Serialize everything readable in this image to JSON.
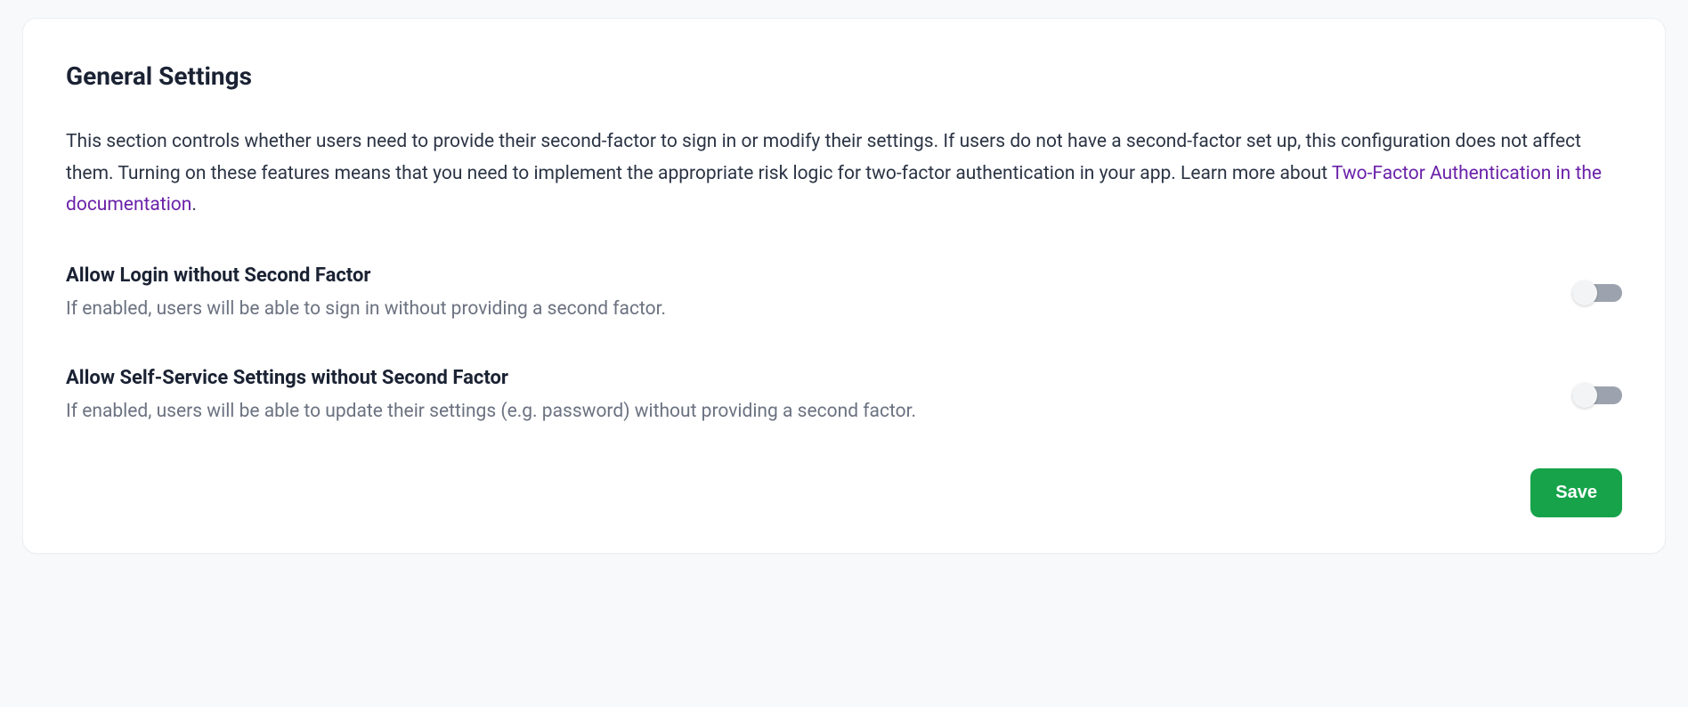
{
  "header": {
    "title": "General Settings"
  },
  "description": {
    "text_before": "This section controls whether users need to provide their second-factor to sign in or modify their settings. If users do not have a second-factor set up, this configuration does not affect them. Turning on these features means that you need to implement the appropriate risk logic for two-factor authentication in your app. Learn more about ",
    "link_text": "Two-Factor Authentication in the documentation",
    "text_after": "."
  },
  "settings": {
    "login": {
      "title": "Allow Login without Second Factor",
      "subtitle": "If enabled, users will be able to sign in without providing a second factor.",
      "enabled": false
    },
    "self_service": {
      "title": "Allow Self-Service Settings without Second Factor",
      "subtitle": "If enabled, users will be able to update their settings (e.g. password) without providing a second factor.",
      "enabled": false
    }
  },
  "actions": {
    "save_label": "Save"
  }
}
